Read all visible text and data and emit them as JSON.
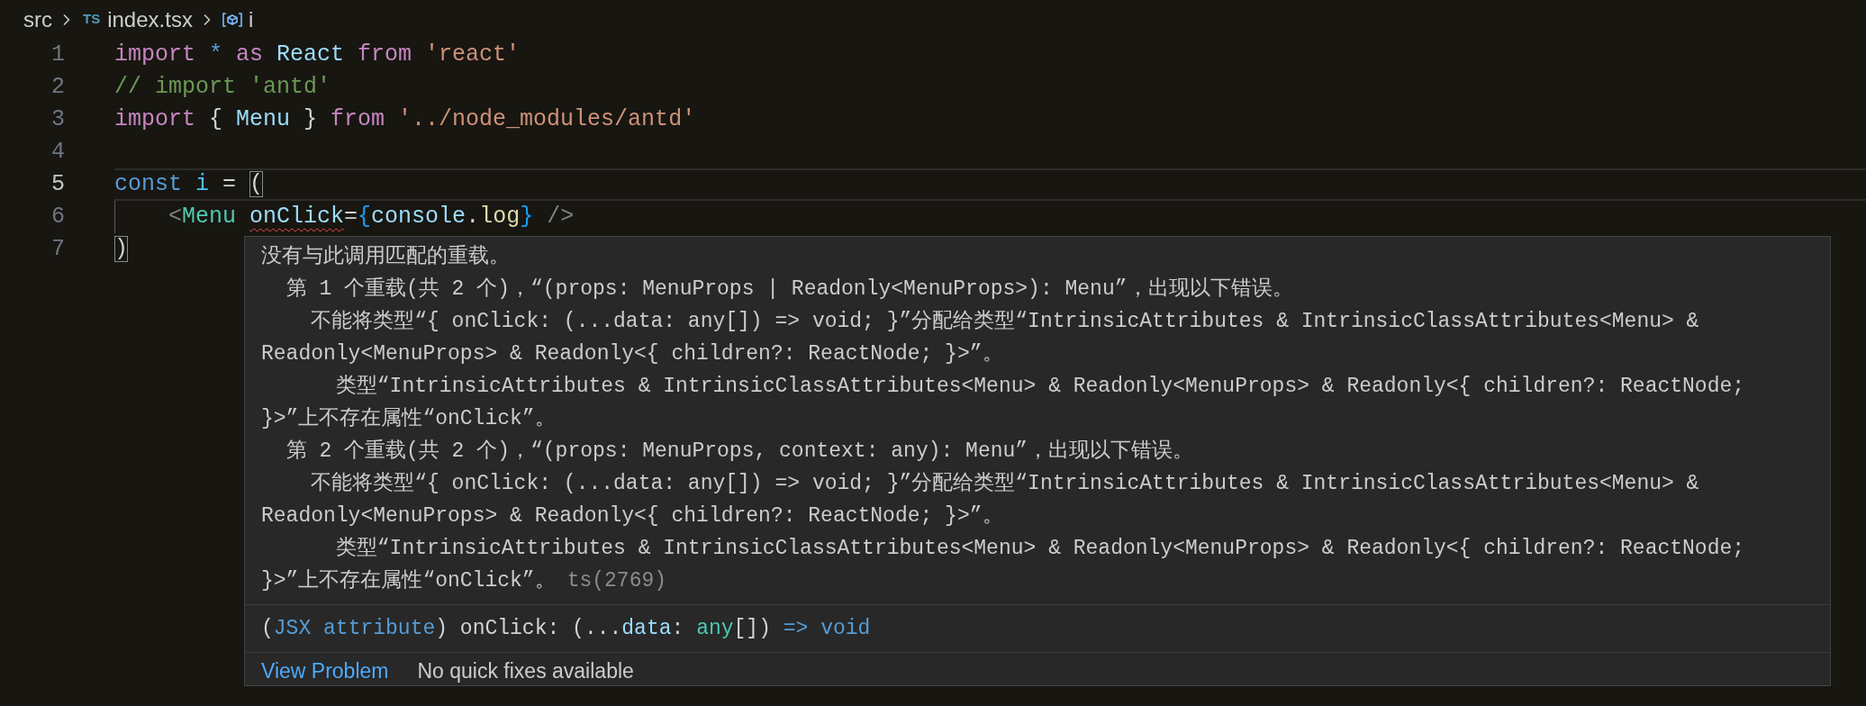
{
  "breadcrumb": {
    "folder": "src",
    "file_badge": "TS",
    "file": "index.tsx",
    "symbol": "i"
  },
  "editor": {
    "lines": [
      {
        "number": "1",
        "current": false,
        "tokens": [
          {
            "text": "import ",
            "kind": "keyword"
          },
          {
            "text": "* ",
            "kind": "storage"
          },
          {
            "text": "as ",
            "kind": "keyword"
          },
          {
            "text": "React ",
            "kind": "variable"
          },
          {
            "text": "from ",
            "kind": "keyword"
          },
          {
            "text": "'react'",
            "kind": "string"
          }
        ]
      },
      {
        "number": "2",
        "current": false,
        "tokens": [
          {
            "text": "// import 'antd'",
            "kind": "comment"
          }
        ]
      },
      {
        "number": "3",
        "current": false,
        "tokens": [
          {
            "text": "import",
            "kind": "keyword"
          },
          {
            "text": " { ",
            "kind": "plain"
          },
          {
            "text": "Menu",
            "kind": "variable"
          },
          {
            "text": " } ",
            "kind": "plain"
          },
          {
            "text": "from ",
            "kind": "keyword"
          },
          {
            "text": "'../node_modules/antd'",
            "kind": "string"
          }
        ]
      },
      {
        "number": "4",
        "current": false
      },
      {
        "number": "5",
        "current": true,
        "tokens": [
          {
            "text": "const ",
            "kind": "storage"
          },
          {
            "text": "i",
            "kind": "constant"
          },
          {
            "text": " = ",
            "kind": "plain"
          },
          {
            "text": "(",
            "kind": "plain",
            "matched": true
          }
        ]
      },
      {
        "number": "6",
        "current": false,
        "indent_guide": true,
        "tokens": [
          {
            "text": "<",
            "kind": "tagpunct"
          },
          {
            "text": "Menu ",
            "kind": "component"
          },
          {
            "text": "onClick",
            "kind": "variable",
            "error": true
          },
          {
            "text": "=",
            "kind": "plain"
          },
          {
            "text": "{",
            "kind": "bracket"
          },
          {
            "text": "console",
            "kind": "variable"
          },
          {
            "text": ".",
            "kind": "plain"
          },
          {
            "text": "log",
            "kind": "function"
          },
          {
            "text": "}",
            "kind": "bracket"
          },
          {
            "text": " />",
            "kind": "tagpunct"
          }
        ]
      },
      {
        "number": "7",
        "current": false,
        "tokens": [
          {
            "text": ")",
            "kind": "plain",
            "matched": true
          }
        ]
      }
    ]
  },
  "hover": {
    "message": "没有与此调用匹配的重载。",
    "children": [
      {
        "message": "第 1 个重载(共 2 个)，“(props: MenuProps | Readonly<MenuProps>): Menu”，出现以下错误。",
        "children": [
          {
            "message": "不能将类型“{ onClick: (...data: any[]) => void; }”分配给类型“IntrinsicAttributes & IntrinsicClassAttributes<Menu> & Readonly<MenuProps> & Readonly<{ children?: ReactNode; }>”。",
            "children": [
              {
                "message": "类型“IntrinsicAttributes & IntrinsicClassAttributes<Menu> & Readonly<MenuProps> & Readonly<{ children?: ReactNode; }>”上不存在属性“onClick”。"
              }
            ]
          }
        ]
      },
      {
        "message": "第 2 个重载(共 2 个)，“(props: MenuProps, context: any): Menu”，出现以下错误。",
        "children": [
          {
            "message": "不能将类型“{ onClick: (...data: any[]) => void; }”分配给类型“IntrinsicAttributes & IntrinsicClassAttributes<Menu> & Readonly<MenuProps> & Readonly<{ children?: ReactNode; }>”。",
            "children": [
              {
                "message": "类型“IntrinsicAttributes & IntrinsicClassAttributes<Menu> & Readonly<MenuProps> & Readonly<{ children?: ReactNode; }>”上不存在属性“onClick”。"
              }
            ]
          }
        ]
      }
    ],
    "code": "ts(2769)",
    "signature": [
      {
        "text": "(",
        "kind": "plain"
      },
      {
        "text": "JSX attribute",
        "kind": "storage"
      },
      {
        "text": ") onClick: (...",
        "kind": "plain"
      },
      {
        "text": "data",
        "kind": "variable"
      },
      {
        "text": ": ",
        "kind": "plain"
      },
      {
        "text": "any",
        "kind": "component"
      },
      {
        "text": "[]) ",
        "kind": "plain"
      },
      {
        "text": "=> void",
        "kind": "storage"
      }
    ],
    "actions": {
      "link": "View Problem",
      "note": "No quick fixes available"
    }
  }
}
